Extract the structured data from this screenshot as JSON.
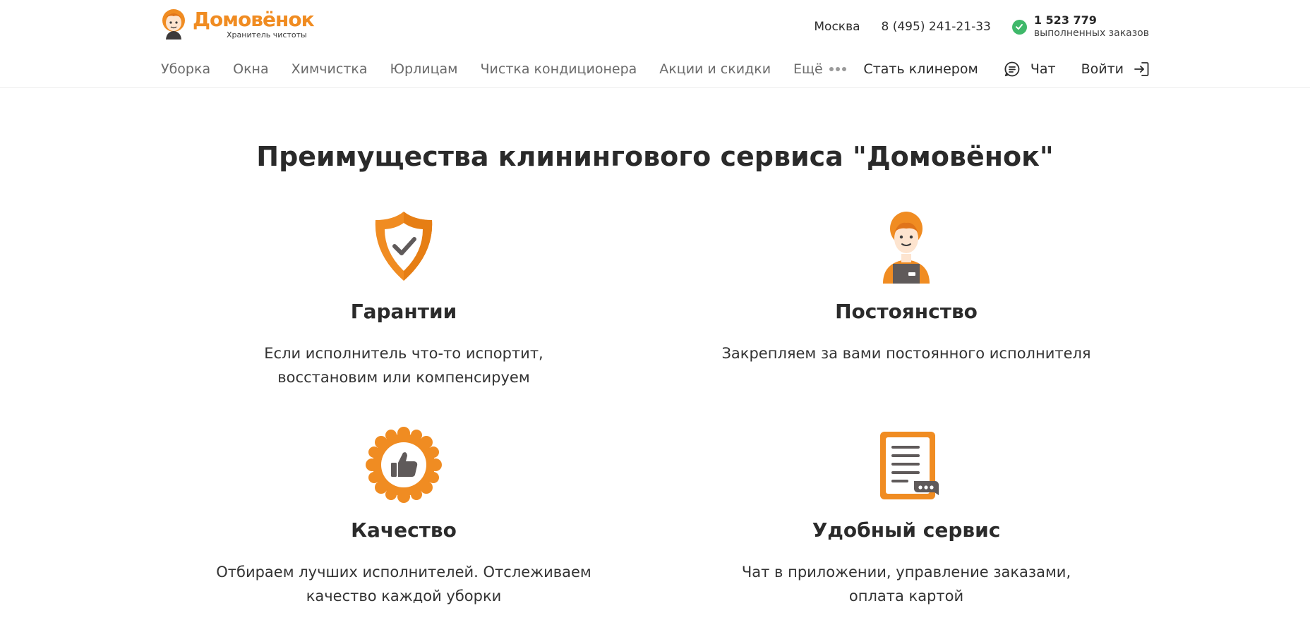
{
  "header": {
    "logo": {
      "name": "Домовёнок",
      "tagline": "Хранитель чистоты"
    },
    "city": "Москва",
    "phone": "8 (495) 241-21-33",
    "orders": {
      "count": "1 523 779",
      "label": "выполненных заказов"
    },
    "nav": [
      {
        "label": "Уборка"
      },
      {
        "label": "Окна"
      },
      {
        "label": "Химчистка"
      },
      {
        "label": "Юрлицам"
      },
      {
        "label": "Чистка кондиционера"
      },
      {
        "label": "Акции и скидки"
      }
    ],
    "more_label": "Ещё",
    "become_cleaner": "Стать клинером",
    "chat": "Чат",
    "login": "Войти"
  },
  "advantages": {
    "title": "Преимущества клинингового сервиса \"Домовёнок\"",
    "items": [
      {
        "icon": "shield-check-icon",
        "title": "Гарантии",
        "text_line1": "Если исполнитель что-то испортит,",
        "text_line2": "восстановим или компенсируем"
      },
      {
        "icon": "cleaner-person-icon",
        "title": "Постоянство",
        "text_line1": "Закрепляем за вами постоянного исполнителя",
        "text_line2": ""
      },
      {
        "icon": "quality-badge-icon",
        "title": "Качество",
        "text_line1": "Отбираем лучших исполнителей. Отслеживаем",
        "text_line2": "качество каждой уборки"
      },
      {
        "icon": "document-chat-icon",
        "title": "Удобный сервис",
        "text_line1": "Чат в приложении, управление заказами,",
        "text_line2": "оплата картой"
      }
    ]
  },
  "colors": {
    "brand_orange": "#f08c22",
    "success_green": "#3fb86a",
    "icon_dark": "#5f5a5a"
  }
}
